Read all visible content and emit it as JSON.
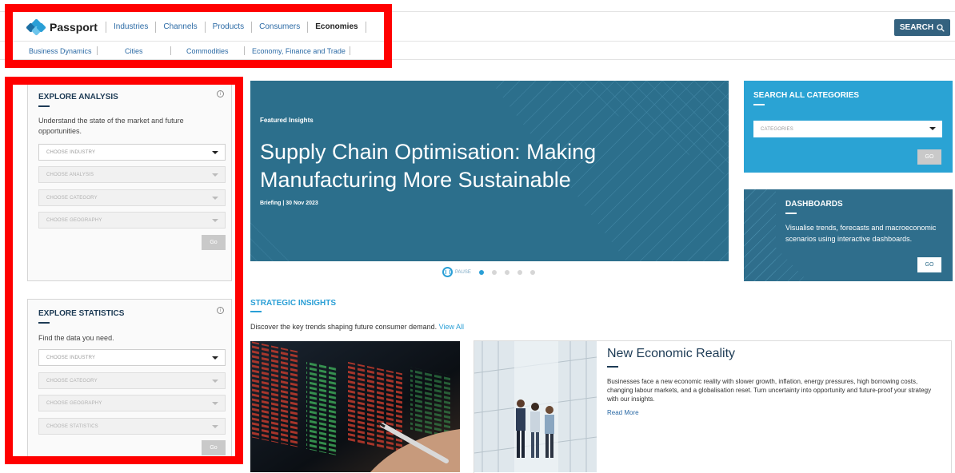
{
  "brand": {
    "name": "Passport"
  },
  "main_nav": [
    {
      "label": "Industries",
      "active": false
    },
    {
      "label": "Channels",
      "active": false
    },
    {
      "label": "Products",
      "active": false
    },
    {
      "label": "Consumers",
      "active": false
    },
    {
      "label": "Economies",
      "active": true
    }
  ],
  "search_button": {
    "label": "SEARCH",
    "icon": "search-icon"
  },
  "sub_nav": [
    "Business Dynamics",
    "Cities",
    "Commodities",
    "Economy, Finance and Trade"
  ],
  "explore_analysis": {
    "title": "EXPLORE ANALYSIS",
    "description": "Understand the state of the market and future opportunities.",
    "selects": [
      {
        "placeholder": "CHOOSE INDUSTRY",
        "enabled": true
      },
      {
        "placeholder": "CHOOSE ANALYSIS",
        "enabled": false
      },
      {
        "placeholder": "CHOOSE CATEGORY",
        "enabled": false
      },
      {
        "placeholder": "CHOOSE GEOGRAPHY",
        "enabled": false
      }
    ],
    "go_label": "Go"
  },
  "explore_statistics": {
    "title": "EXPLORE STATISTICS",
    "description": "Find the data you need.",
    "selects": [
      {
        "placeholder": "CHOOSE INDUSTRY",
        "enabled": true
      },
      {
        "placeholder": "CHOOSE CATEGORY",
        "enabled": false
      },
      {
        "placeholder": "CHOOSE GEOGRAPHY",
        "enabled": false
      },
      {
        "placeholder": "CHOOSE STATISTICS",
        "enabled": false
      }
    ],
    "go_label": "Go"
  },
  "hero": {
    "kicker": "Featured Insights",
    "title": "Supply Chain Optimisation: Making Manufacturing More Sustainable",
    "meta": "Briefing | 30 Nov 2023",
    "pause_label": "PAUSE",
    "slide_count": 5,
    "active_slide": 1
  },
  "search_all": {
    "title": "SEARCH ALL CATEGORIES",
    "placeholder": "CATEGORIES",
    "go_label": "GO"
  },
  "dashboards": {
    "title": "DASHBOARDS",
    "description": "Visualise trends, forecasts and macroeconomic scenarios using interactive dashboards.",
    "go_label": "GO"
  },
  "strategic_insights": {
    "title": "STRATEGIC INSIGHTS",
    "description": "Discover the key trends shaping future consumer demand.",
    "view_all": "View All",
    "feature": {
      "title": "New Economic Reality",
      "body": "Businesses face a new economic reality with slower growth, inflation, energy pressures, high borrowing costs, changing labour markets, and a globalisation reset. Turn uncertainty into opportunity and future-proof your strategy with our insights.",
      "read_more": "Read More"
    }
  },
  "colors": {
    "accent": "#2a9fd6",
    "navy": "#1d3b55",
    "hero_bg": "#2c6f8c",
    "highlight": "#ff0000",
    "search_btn": "#34627f"
  }
}
